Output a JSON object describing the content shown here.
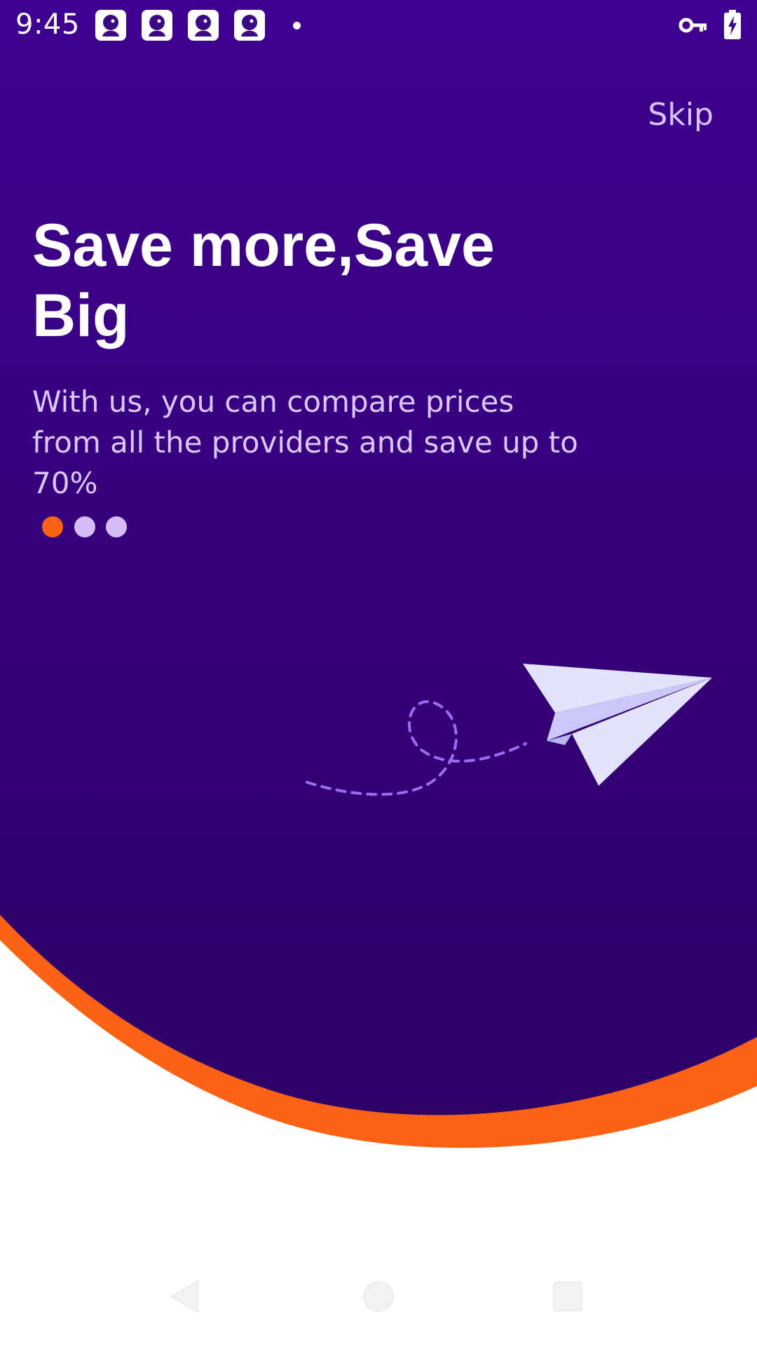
{
  "status_bar": {
    "time": "9:45",
    "notification_icons": [
      "app-notification-icon",
      "app-notification-icon",
      "app-notification-icon",
      "app-notification-icon"
    ],
    "more_indicator": "notification-dot-icon",
    "right_icons": [
      "vpn-key-icon",
      "battery-charging-icon"
    ]
  },
  "onboarding": {
    "skip_label": "Skip",
    "title": "Save more,Save Big",
    "description": "With us, you can compare prices from all the providers and save up to 70%",
    "page_indicator": {
      "total": 3,
      "active_index": 0
    },
    "illustration": "paper-plane-icon"
  },
  "nav_bar": {
    "buttons": [
      "back-icon",
      "home-icon",
      "recents-icon"
    ]
  },
  "colors": {
    "background_top": "#3e0190",
    "background_bottom": "#2e0167",
    "accent_orange": "#fb6214",
    "dot_inactive": "#d7bdf7",
    "skip_text": "#d9c4f7",
    "subtext": "#dcc8f8",
    "plane_light": "#e4e3fc",
    "plane_shade": "#c9c8f7",
    "trail": "#9b6cf2"
  }
}
